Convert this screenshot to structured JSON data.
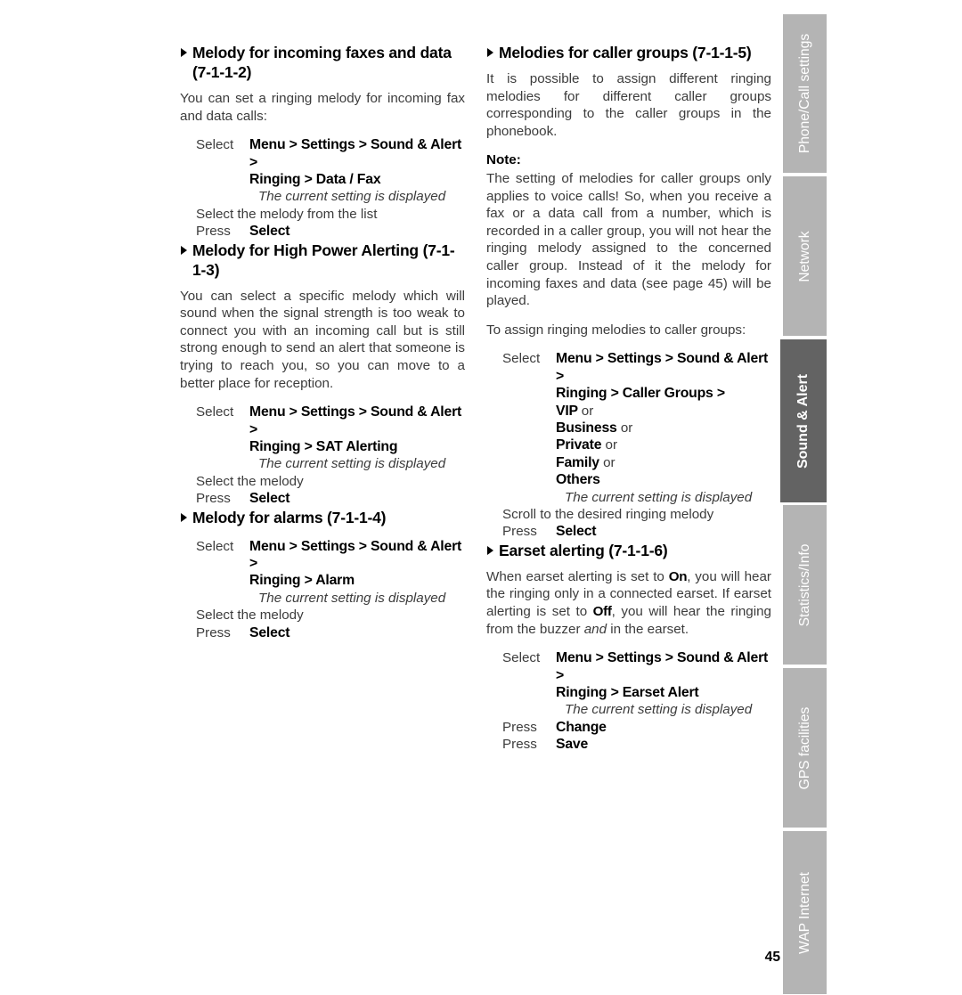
{
  "document": {
    "page_number": "45"
  },
  "side_tabs": [
    {
      "label": "Phone/Call settings",
      "active": false
    },
    {
      "label": "Network",
      "active": false
    },
    {
      "label": "Sound & Alert",
      "active": true
    },
    {
      "label": "Statistics/Info",
      "active": false
    },
    {
      "label": "GPS facilities",
      "active": false
    },
    {
      "label": "WAP Internet",
      "active": false
    }
  ],
  "colors": {
    "tab_inactive_bg": "#b4b4b4",
    "tab_active_bg": "#636363",
    "tab_text": "#ffffff",
    "body_text": "#3c3c3c",
    "heading_text": "#000000"
  },
  "left_column": {
    "sections": [
      {
        "heading": "Melody for incoming faxes and data (7-1-1-2)",
        "paragraph": "You can set a ringing melody for incoming fax and data calls:",
        "instructions": {
          "select_label": "Select",
          "path_line1_pre": "Menu > Settings > Sound & Alert >",
          "path_line2": "Ringing > Data / Fax",
          "hint": "The current setting is displayed",
          "step_line": "Select the melody from the list",
          "press_label": "Press",
          "press_value": "Select"
        }
      },
      {
        "heading": "Melody for High Power Alerting (7-1-1-3)",
        "paragraph": "You can select a specific melody which will sound when the signal strength is too weak to connect you with an incoming call but is still strong enough to send an alert that someone is trying to reach you, so you can move to a better place for reception.",
        "instructions": {
          "select_label": "Select",
          "path_line1_pre": "Menu > Settings > Sound & Alert >",
          "path_line2": "Ringing > SAT Alerting",
          "hint": "The current setting is displayed",
          "step_line": "Select the melody",
          "press_label": "Press",
          "press_value": "Select"
        }
      },
      {
        "heading": "Melody for alarms (7-1-1-4)",
        "instructions": {
          "select_label": "Select",
          "path_line1_pre": "Menu > Settings > Sound & Alert >",
          "path_line2": "Ringing > Alarm",
          "hint": "The current setting is displayed",
          "step_line": "Select the melody",
          "press_label": "Press",
          "press_value": "Select"
        }
      }
    ]
  },
  "right_column": {
    "sections": [
      {
        "heading": "Melodies for caller groups (7-1-1-5)",
        "paragraph": "It is possible to assign different ringing melodies for different caller groups corresponding to the caller groups in the phonebook.",
        "note_label": "Note:",
        "note_body_1": "The setting of melodies for caller groups only applies to voice calls! So, when you receive a fax or a data call from a number, which is recorded in a caller group, you will not hear the ringing melody assigned to the concerned caller group. Instead of it the melody for incoming faxes and data (see page 45) will be played.",
        "lead_in": "To assign ringing melodies to caller groups:",
        "instructions": {
          "select_label": "Select",
          "path_line1_pre": "Menu > Settings > Sound & Alert >",
          "path_line2": "Ringing > Caller Groups >",
          "option_1": "VIP",
          "option_1_or": "or",
          "option_2": "Business",
          "option_2_or": "or",
          "option_3": "Private",
          "option_3_or": "or",
          "option_4": "Family",
          "option_4_or": "or",
          "option_5": "Others",
          "hint": "The current setting is displayed",
          "step_line": "Scroll to the desired ringing melody",
          "press_label": "Press",
          "press_value": "Select"
        }
      },
      {
        "heading": "Earset alerting (7-1-1-6)",
        "paragraph_parts": {
          "p1": "When earset alerting is set to ",
          "on": "On",
          "p2": ", you will hear the ringing only in a connected earset. If earset alerting is set to ",
          "off": "Off",
          "p3": ", you will hear the ringing from the buzzer ",
          "and": "and",
          "p4": " in the earset."
        },
        "instructions": {
          "select_label": "Select",
          "path_line1_pre": "Menu > Settings > Sound & Alert >",
          "path_line2": "Ringing > Earset Alert",
          "hint": "The current setting is displayed",
          "press_label_1": "Press",
          "press_value_1": "Change",
          "press_label_2": "Press",
          "press_value_2": "Save"
        }
      }
    ]
  }
}
